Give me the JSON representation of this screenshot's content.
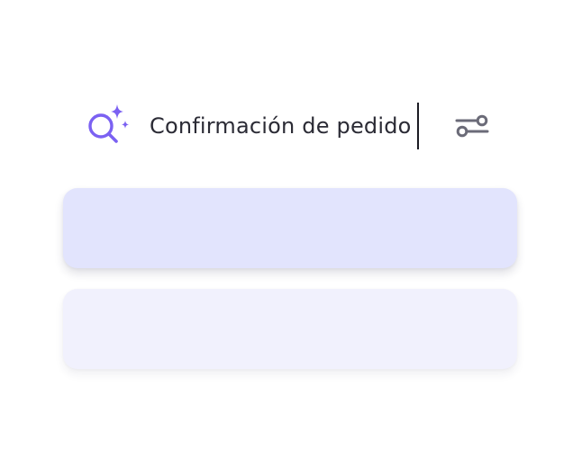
{
  "search": {
    "query": "Confirmación de pedido",
    "icon": "ai-search-icon",
    "filter_icon": "filter-sliders-icon",
    "accent_color": "#7b61f2",
    "icon_gray": "#6b6b78"
  },
  "results": [
    {
      "name": "result-card-1",
      "background": "#e2e4fd"
    },
    {
      "name": "result-card-2",
      "background": "#f1f1fd"
    }
  ]
}
